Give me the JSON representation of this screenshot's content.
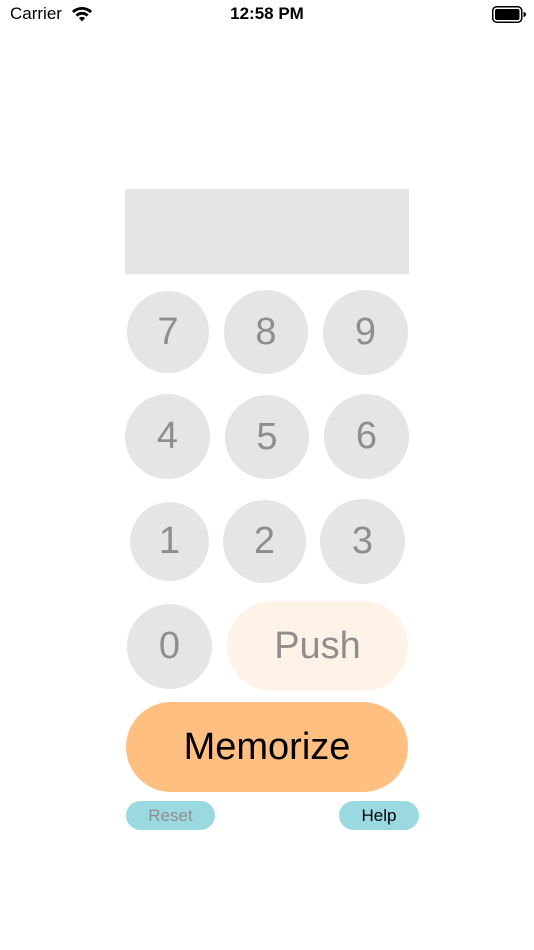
{
  "status_bar": {
    "carrier": "Carrier",
    "time": "12:58 PM",
    "wifi_icon": "wifi-icon",
    "battery_icon": "battery-icon"
  },
  "display": {
    "value": ""
  },
  "keypad": {
    "keys": [
      "7",
      "8",
      "9",
      "4",
      "5",
      "6",
      "1",
      "2",
      "3",
      "0"
    ]
  },
  "actions": {
    "push_label": "Push",
    "memorize_label": "Memorize",
    "reset_label": "Reset",
    "help_label": "Help"
  },
  "colors": {
    "key_bg": "#e5e5e5",
    "key_text": "#8e8e8e",
    "push_bg": "#fff2e6",
    "memorize_bg": "#ffbf80",
    "small_button_bg": "#9bd9e1"
  }
}
